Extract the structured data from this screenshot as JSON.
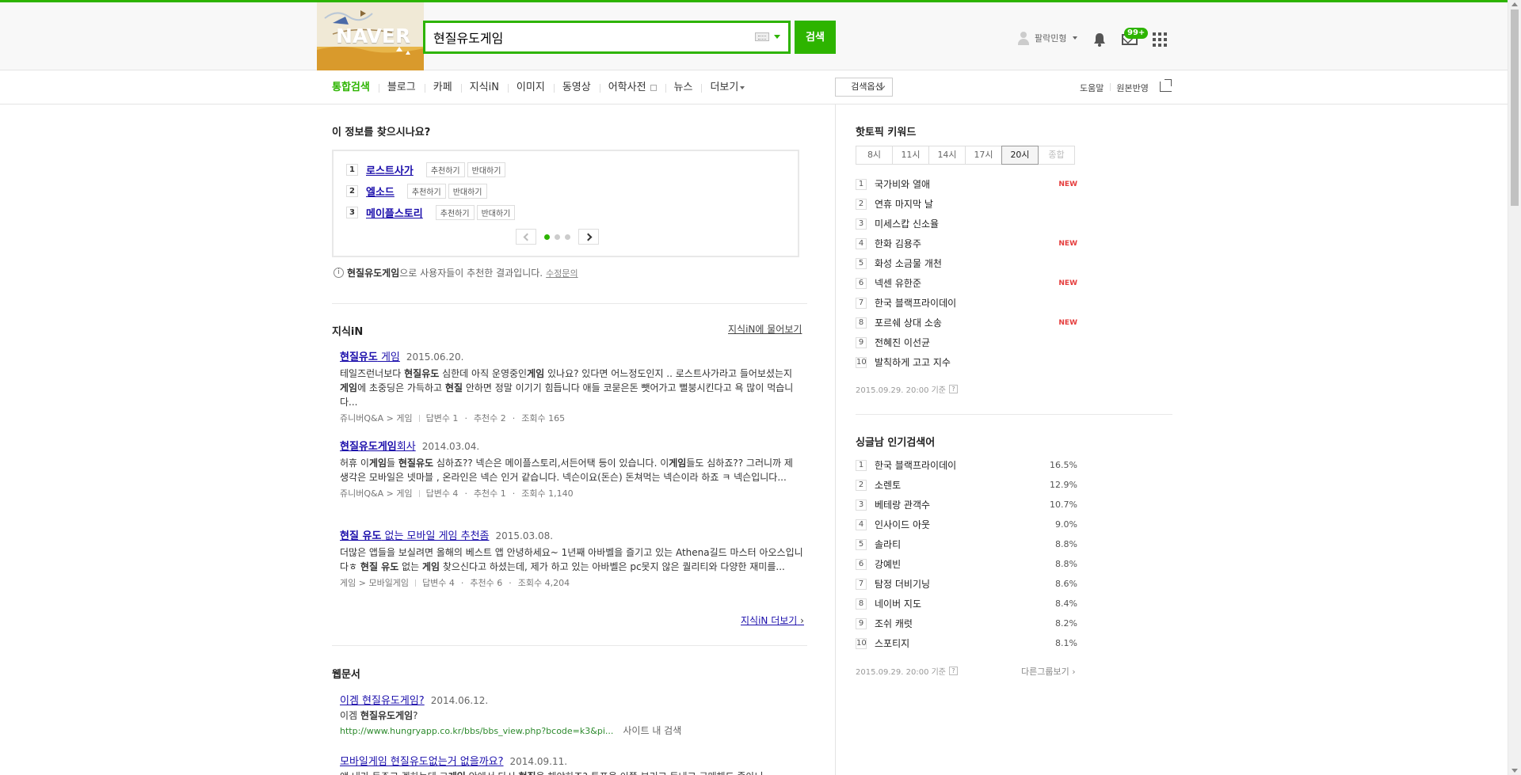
{
  "header": {
    "logo": "NAVER",
    "search_value": "현질유도게임",
    "search_button": "검색",
    "user_name": "팔락민형",
    "mail_badge": "99+"
  },
  "nav": {
    "tabs": [
      "통합검색",
      "블로그",
      "카페",
      "지식iN",
      "이미지",
      "동영상",
      "어학사전",
      "뉴스",
      "더보기"
    ],
    "search_options": "검색옵션",
    "right_links": [
      "도움말",
      "원본반영"
    ]
  },
  "recommend": {
    "title": "이 정보를 찾으시나요?",
    "items": [
      {
        "num": "1",
        "label": "로스트사가",
        "up": "추천하기",
        "down": "반대하기"
      },
      {
        "num": "2",
        "label": "엘소드",
        "up": "추천하기",
        "down": "반대하기"
      },
      {
        "num": "3",
        "label": "메이플스토리",
        "up": "추천하기",
        "down": "반대하기"
      }
    ],
    "info_keyword": "현질유도게임",
    "info_text": "으로 사용자들이 추천한 결과입니다.",
    "info_link": "수정문의"
  },
  "kin": {
    "title": "지식iN",
    "ask_link": "지식iN에 물어보기",
    "more_link": "지식iN 더보기",
    "results": [
      {
        "title_pre": "",
        "title_b": "현질유도",
        "title_post": " 게임",
        "date": "2015.06.20.",
        "body": "테일즈런너보다 <b>현질유도</b> 심한데 아직 운영중인<b>게임</b> 있나요? 있다면 어느정도인지 .. 로스트사가라고 들어보셨는지 <b>게임</b>에 초중딩은 가득하고 <b>현질</b> 안하면 정말 이기기 힘듭니다 애들 코묻은돈 뺏어가고 뻘붕시킨다고 욕 많이 먹습니다...",
        "category": "쥬니버Q&A > 게임",
        "answers": "답변수 1",
        "likes": "추천수 2",
        "views": "조회수 165"
      },
      {
        "title_pre": "",
        "title_b": "현질유도게임",
        "title_post": "회사",
        "date": "2014.03.04.",
        "body": "허휴 이<b>게임</b>들 <b>현질유도</b> 심하죠?? 넥슨은 메이플스토리,서든어택 등이 있습니다. 이<b>게임</b>들도 심하죠?? 그러니까 제 생각은 모바일은 넷마블 , 온라인은 넥슨 인거 같습니다. 넥슨이요(돈슨) 돈쳐먹는 넥슨이라 하죠 ㅋ 넥슨입니다...",
        "category": "쥬니버Q&A > 게임",
        "answers": "답변수 4",
        "likes": "추천수 1",
        "views": "조회수 1,140"
      },
      {
        "title_pre": "",
        "title_b": "현질 유도",
        "title_post": " 없는 모바일 게임 추천좀",
        "date": "2015.03.08.",
        "body": "더많은 앱들을 보실려면 올해의 베스트 앱 안녕하세요~ 1년째 아바벨을 즐기고 있는 Athena길드 마스터 아오스입니다ㅎ <b>현질 유도</b> 없는 <b>게임</b> 찾으신다고 하셨는데, 제가 하고 있는 아바벨은 pc못지 않은 퀄리티와 다양한 재미를...",
        "category": "게임 > 모바일게임",
        "answers": "답변수 4",
        "likes": "추천수 6",
        "views": "조회수 4,204"
      }
    ]
  },
  "web": {
    "title": "웹문서",
    "results": [
      {
        "title": "이겜 현질유도게임?",
        "date": "2014.06.12.",
        "body": "이겜 <b>현질유도게임</b>?",
        "url": "http://www.hungryapp.co.kr/bbs/bbs_view.php?bcode=k3&pi...",
        "site_search": "사이트 내 검색"
      },
      {
        "title": "모바일게임 현질유도없는거 없을까요?",
        "date": "2014.09.11.",
        "body": "얘 내가 돈주고 겜하는데 그<b>게임</b> 안에서 다시 <b>현질</b>을 해야하죠? 투표을 이쯤 부리고 돈내고 구매해도 좋아니"
      }
    ]
  },
  "hot_keywords": {
    "title": "핫토픽 키워드",
    "hours": [
      "8시",
      "11시",
      "14시",
      "17시",
      "20시",
      "종합"
    ],
    "active_hour": "20시",
    "items": [
      {
        "num": "1",
        "text": "국가비와 열애",
        "badge": "NEW"
      },
      {
        "num": "2",
        "text": "연휴 마지막 날",
        "badge": ""
      },
      {
        "num": "3",
        "text": "미세스캅 신소율",
        "badge": ""
      },
      {
        "num": "4",
        "text": "한화 김용주",
        "badge": "NEW"
      },
      {
        "num": "5",
        "text": "화성 소금물 개천",
        "badge": ""
      },
      {
        "num": "6",
        "text": "넥센 유한준",
        "badge": "NEW"
      },
      {
        "num": "7",
        "text": "한국 블랙프라이데이",
        "badge": ""
      },
      {
        "num": "8",
        "text": "포르쉐 상대 소송",
        "badge": "NEW"
      },
      {
        "num": "9",
        "text": "전혜진 이선균",
        "badge": ""
      },
      {
        "num": "10",
        "text": "발칙하게 고고 지수",
        "badge": ""
      }
    ],
    "stamp": "2015.09.29. 20:00 기준"
  },
  "singles": {
    "title": "싱글남 인기검색어",
    "items": [
      {
        "num": "1",
        "text": "한국 블랙프라이데이",
        "pct": "16.5%"
      },
      {
        "num": "2",
        "text": "소렌토",
        "pct": "12.9%"
      },
      {
        "num": "3",
        "text": "베테랑 관객수",
        "pct": "10.7%"
      },
      {
        "num": "4",
        "text": "인사이드 아웃",
        "pct": "9.0%"
      },
      {
        "num": "5",
        "text": "솔라티",
        "pct": "8.8%"
      },
      {
        "num": "6",
        "text": "강예빈",
        "pct": "8.8%"
      },
      {
        "num": "7",
        "text": "탐정 더비기닝",
        "pct": "8.6%"
      },
      {
        "num": "8",
        "text": "네이버 지도",
        "pct": "8.4%"
      },
      {
        "num": "9",
        "text": "조쉬 캐럿",
        "pct": "8.2%"
      },
      {
        "num": "10",
        "text": "스포티지",
        "pct": "8.1%"
      }
    ],
    "stamp": "2015.09.29. 20:00 기준",
    "other_group": "다른그룹보기"
  },
  "colors": {
    "accent": "#2db400",
    "link": "#1a0dab",
    "new": "#e53d3d"
  }
}
